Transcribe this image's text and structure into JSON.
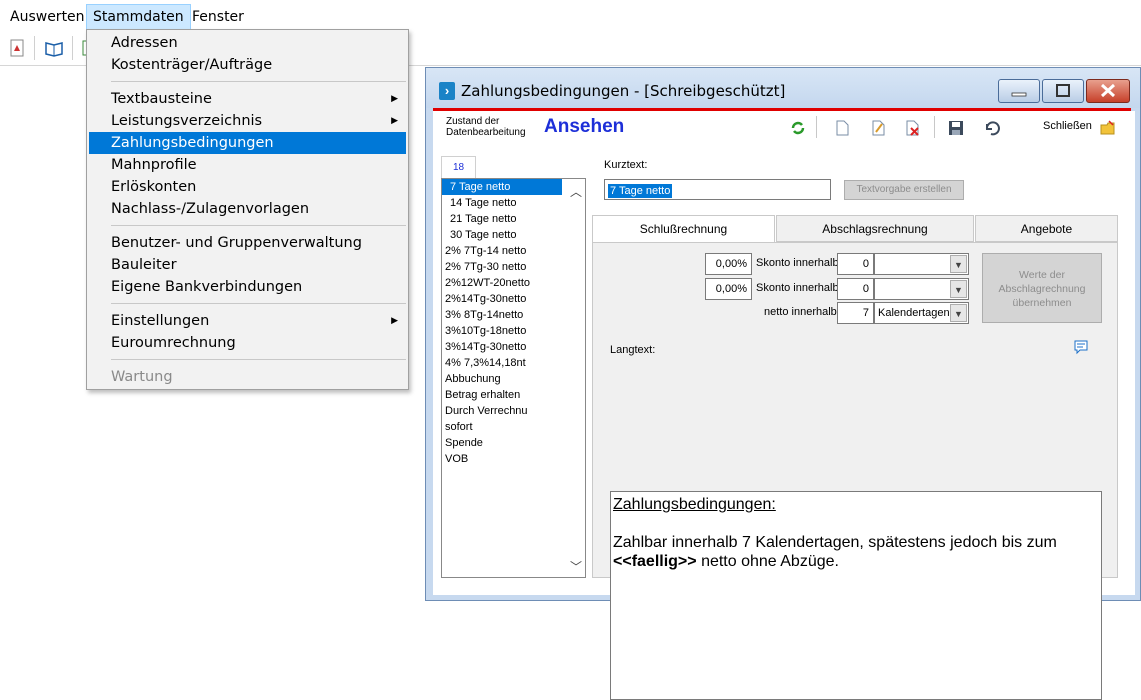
{
  "menubar": {
    "items": [
      "Auswerten",
      "Stammdaten",
      "Fenster"
    ]
  },
  "dropdown": {
    "groups": [
      [
        "Adressen",
        "Kostenträger/Aufträge"
      ],
      [
        "Textbausteine",
        "Leistungsverzeichnis",
        "Zahlungsbedingungen",
        "Mahnprofile",
        "Erlöskonten",
        "Nachlass-/Zulagenvorlagen"
      ],
      [
        "Benutzer- und Gruppenverwaltung",
        "Bauleiter",
        "Eigene Bankverbindungen"
      ],
      [
        "Einstellungen",
        "Euroumrechnung"
      ],
      [
        "Wartung"
      ]
    ],
    "selected": "Zahlungsbedingungen",
    "disabled": "Wartung"
  },
  "window": {
    "title": "Zahlungsbedingungen - [Schreibgeschützt]",
    "zustand_label": "Zustand der Datenbearbeitung",
    "zustand_value": "Ansehen",
    "close_label": "Schließen",
    "count": "18",
    "list": [
      "7 Tage netto",
      "14 Tage netto",
      "21 Tage netto",
      "30 Tage netto",
      "2% 7Tg-14 netto",
      "2% 7Tg-30 netto",
      "2%12WT-20netto",
      "2%14Tg-30netto",
      "3% 8Tg-14netto",
      "3%10Tg-18netto",
      "3%14Tg-30netto",
      "4% 7,3%14,18nt",
      "Abbuchung",
      "Betrag erhalten",
      "Durch Verrechnu",
      "sofort",
      "Spende",
      "VOB"
    ],
    "kurztext_label": "Kurztext:",
    "kurztext_value": "7 Tage netto",
    "textvorgabe_button": "Textvorgabe erstellen",
    "tabs": [
      "Schlußrechnung",
      "Abschlagsrechnung",
      "Angebote"
    ],
    "skonto1_pct": "0,00%",
    "skonto1_label": "Skonto innerhalb",
    "skonto1_days": "0",
    "skonto2_pct": "0,00%",
    "skonto2_label": "Skonto innerhalb",
    "skonto2_days": "0",
    "netto_label": "netto innerhalb",
    "netto_days": "7",
    "netto_unit": "Kalendertagen",
    "werte_button": "Werte der Abschlagrechnung übernehmen",
    "langtext_label": "Langtext:",
    "langtext_heading": "Zahlungsbedingungen:",
    "langtext_line1": "Zahlbar innerhalb 7 Kalendertagen, spätestens jedoch bis zum",
    "langtext_placeholder": "<<faellig>>",
    "langtext_line2": "netto ohne Abzüge."
  }
}
